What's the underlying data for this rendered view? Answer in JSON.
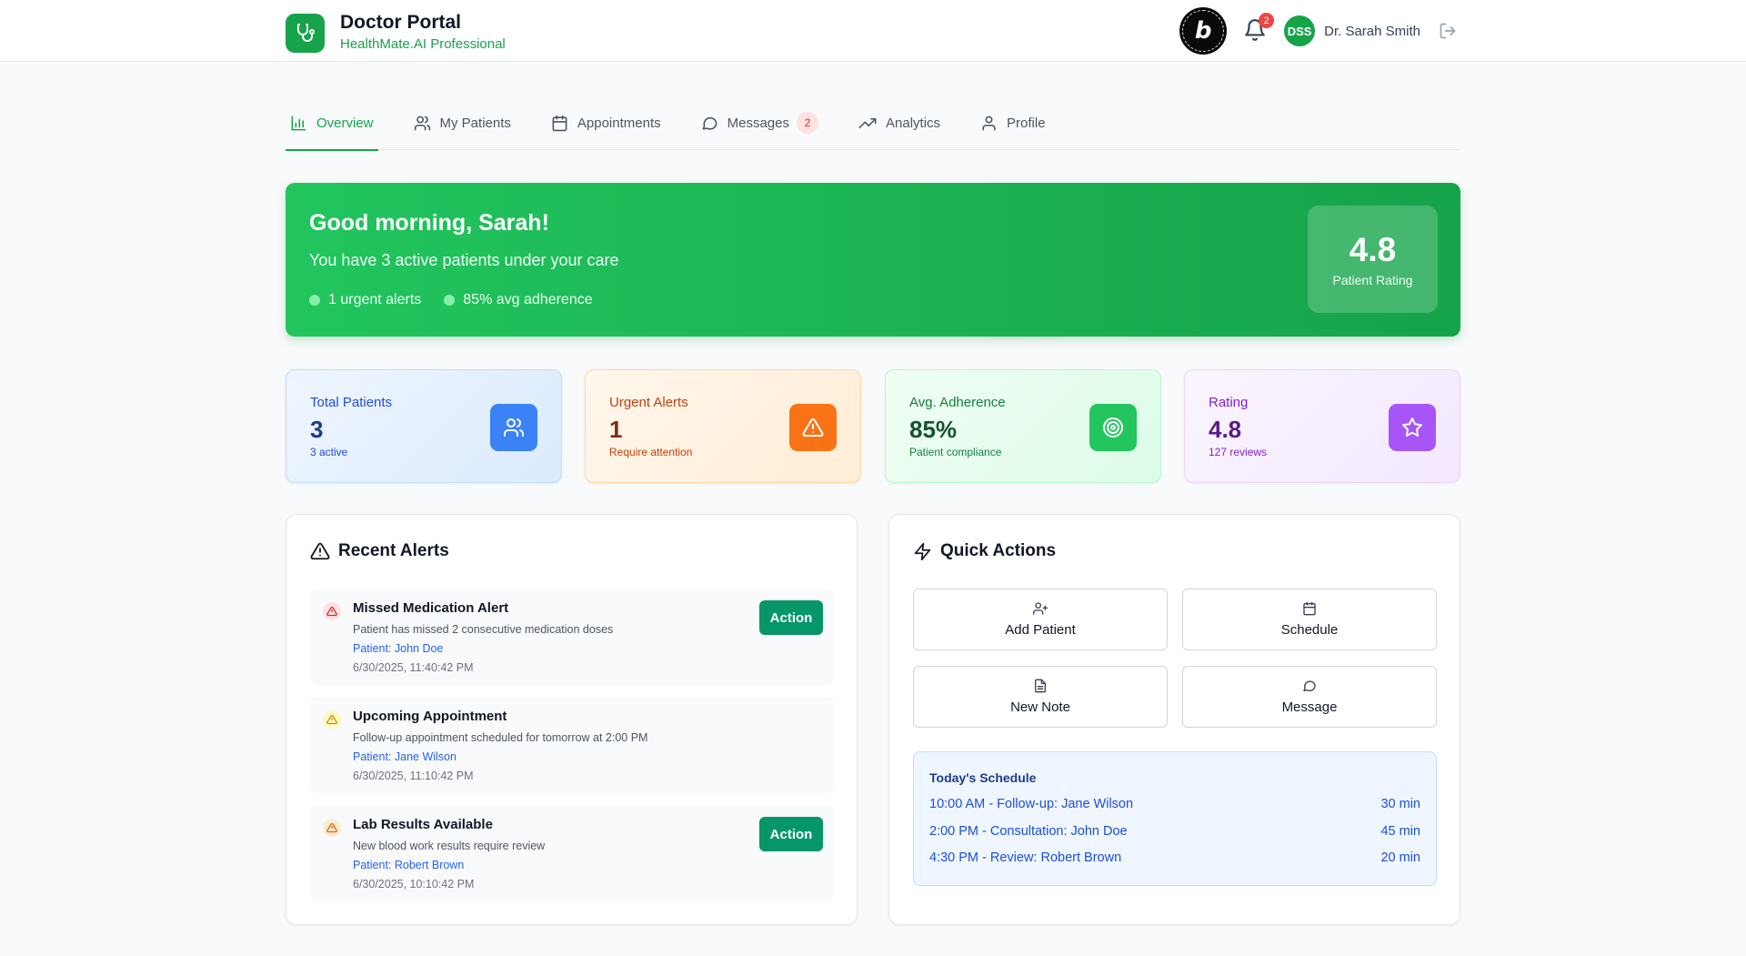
{
  "header": {
    "title": "Doctor Portal",
    "subtitle": "HealthMate.AI Professional",
    "notification_count": "2",
    "avatar_initials": "DSS",
    "user_name": "Dr. Sarah Smith",
    "bolt_letter": "b"
  },
  "tabs": [
    {
      "label": "Overview",
      "icon": "bar-chart-icon",
      "active": true
    },
    {
      "label": "My Patients",
      "icon": "users-icon"
    },
    {
      "label": "Appointments",
      "icon": "calendar-icon"
    },
    {
      "label": "Messages",
      "icon": "message-icon",
      "badge": "2"
    },
    {
      "label": "Analytics",
      "icon": "trending-up-icon"
    },
    {
      "label": "Profile",
      "icon": "user-icon"
    }
  ],
  "hero": {
    "greeting": "Good morning, Sarah!",
    "summary": "You have 3 active patients under your care",
    "stat_alerts": "1 urgent alerts",
    "stat_adherence": "85% avg adherence",
    "rating_value": "4.8",
    "rating_label": "Patient Rating"
  },
  "stats": [
    {
      "label": "Total Patients",
      "value": "3",
      "sub": "3 active",
      "icon": "users-icon",
      "color": "#3b82f6"
    },
    {
      "label": "Urgent Alerts",
      "value": "1",
      "sub": "Require attention",
      "icon": "warning-icon",
      "color": "#f97316"
    },
    {
      "label": "Avg. Adherence",
      "value": "85%",
      "sub": "Patient compliance",
      "icon": "target-icon",
      "color": "#22c55e"
    },
    {
      "label": "Rating",
      "value": "4.8",
      "sub": "127 reviews",
      "icon": "star-icon",
      "color": "#a855f7"
    }
  ],
  "alerts_panel": {
    "title": "Recent Alerts",
    "alerts": [
      {
        "title": "Missed Medication Alert",
        "description": "Patient has missed 2 consecutive medication doses",
        "patient": "Patient: John Doe",
        "time": "6/30/2025, 11:40:42 PM",
        "severity": "high",
        "action": "Action"
      },
      {
        "title": "Upcoming Appointment",
        "description": "Follow-up appointment scheduled for tomorrow at 2:00 PM",
        "patient": "Patient: Jane Wilson",
        "time": "6/30/2025, 11:10:42 PM",
        "severity": "low"
      },
      {
        "title": "Lab Results Available",
        "description": "New blood work results require review",
        "patient": "Patient: Robert Brown",
        "time": "6/30/2025, 10:10:42 PM",
        "severity": "medium",
        "action": "Action"
      }
    ]
  },
  "quick_actions": {
    "title": "Quick Actions",
    "buttons": [
      {
        "label": "Add Patient",
        "icon": "user-plus-icon"
      },
      {
        "label": "Schedule",
        "icon": "calendar-icon"
      },
      {
        "label": "New Note",
        "icon": "file-text-icon"
      },
      {
        "label": "Message",
        "icon": "message-icon"
      }
    ],
    "schedule": {
      "title": "Today's Schedule",
      "items": [
        {
          "text": "10:00 AM - Follow-up: Jane Wilson",
          "duration": "30 min"
        },
        {
          "text": "2:00 PM - Consultation: John Doe",
          "duration": "45 min"
        },
        {
          "text": "4:30 PM - Review: Robert Brown",
          "duration": "20 min"
        }
      ]
    }
  },
  "colors": {
    "primary": "#16a34a",
    "action_button": "#059669",
    "link": "#2563eb"
  }
}
